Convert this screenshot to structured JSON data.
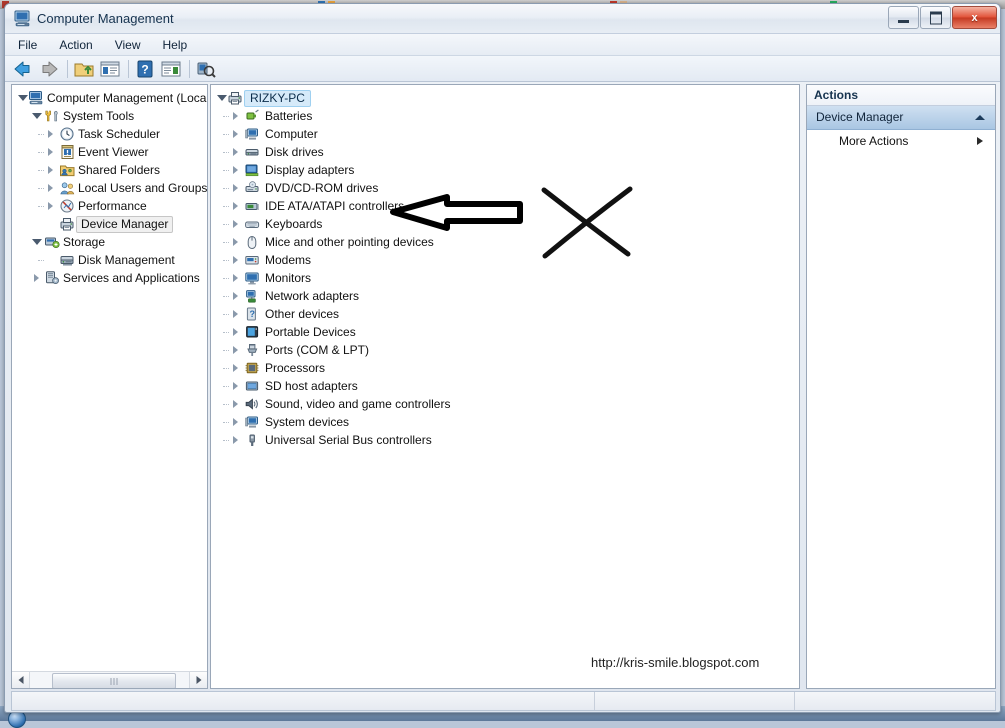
{
  "window": {
    "title": "Computer Management",
    "icon": "computer-management-icon",
    "buttons": {
      "minimize": "minimize",
      "maximize": "maximize",
      "close": "x"
    }
  },
  "menu": {
    "items": [
      "File",
      "Action",
      "View",
      "Help"
    ]
  },
  "toolbar": {
    "buttons": [
      {
        "name": "back-icon",
        "label": "Back"
      },
      {
        "name": "forward-icon",
        "label": "Forward"
      },
      {
        "name": "up-folder-icon",
        "label": "Up One Level"
      },
      {
        "name": "show-console-tree-icon",
        "label": "Show/Hide Console Tree"
      },
      {
        "name": "help-icon",
        "label": "Help"
      },
      {
        "name": "show-action-pane-icon",
        "label": "Show/Hide Action Pane"
      },
      {
        "name": "refresh-scan-icon",
        "label": "Scan for hardware changes"
      }
    ]
  },
  "console_tree": {
    "root": {
      "label": "Computer Management (Local",
      "icon": "computer-icon",
      "state": "expanded"
    },
    "items": [
      {
        "label": "System Tools",
        "icon": "system-tools-icon",
        "indent": 1,
        "state": "expanded",
        "selected": false
      },
      {
        "label": "Task Scheduler",
        "icon": "clock-icon",
        "indent": 2,
        "state": "collapsed",
        "selected": false
      },
      {
        "label": "Event Viewer",
        "icon": "event-viewer-icon",
        "indent": 2,
        "state": "collapsed",
        "selected": false
      },
      {
        "label": "Shared Folders",
        "icon": "shared-folders-icon",
        "indent": 2,
        "state": "collapsed",
        "selected": false
      },
      {
        "label": "Local Users and Groups",
        "icon": "users-icon",
        "indent": 2,
        "state": "collapsed",
        "selected": false
      },
      {
        "label": "Performance",
        "icon": "performance-icon",
        "indent": 2,
        "state": "collapsed",
        "selected": false
      },
      {
        "label": "Device Manager",
        "icon": "device-manager-icon",
        "indent": 2,
        "state": "leaf",
        "selected": true
      },
      {
        "label": "Storage",
        "icon": "storage-icon",
        "indent": 1,
        "state": "expanded",
        "selected": false
      },
      {
        "label": "Disk Management",
        "icon": "disk-management-icon",
        "indent": 2,
        "state": "leaf",
        "selected": false
      },
      {
        "label": "Services and Applications",
        "icon": "services-icon",
        "indent": 1,
        "state": "collapsed",
        "selected": false
      }
    ]
  },
  "device_tree": {
    "root": {
      "label": "RIZKY-PC",
      "icon": "computer-node-icon",
      "state": "expanded",
      "selected": true
    },
    "items": [
      {
        "label": "Batteries",
        "icon": "battery-icon"
      },
      {
        "label": "Computer",
        "icon": "computer-device-icon"
      },
      {
        "label": "Disk drives",
        "icon": "disk-drive-icon"
      },
      {
        "label": "Display adapters",
        "icon": "display-adapter-icon"
      },
      {
        "label": "DVD/CD-ROM drives",
        "icon": "dvd-drive-icon"
      },
      {
        "label": "IDE ATA/ATAPI controllers",
        "icon": "ide-controller-icon"
      },
      {
        "label": "Keyboards",
        "icon": "keyboard-icon"
      },
      {
        "label": "Mice and other pointing devices",
        "icon": "mouse-icon"
      },
      {
        "label": "Modems",
        "icon": "modem-icon"
      },
      {
        "label": "Monitors",
        "icon": "monitor-icon"
      },
      {
        "label": "Network adapters",
        "icon": "network-adapter-icon"
      },
      {
        "label": "Other devices",
        "icon": "other-device-icon"
      },
      {
        "label": "Portable Devices",
        "icon": "portable-device-icon"
      },
      {
        "label": "Ports (COM & LPT)",
        "icon": "port-icon"
      },
      {
        "label": "Processors",
        "icon": "processor-icon"
      },
      {
        "label": "SD host adapters",
        "icon": "sd-host-adapter-icon"
      },
      {
        "label": "Sound, video and game controllers",
        "icon": "sound-icon"
      },
      {
        "label": "System devices",
        "icon": "system-device-icon"
      },
      {
        "label": "Universal Serial Bus controllers",
        "icon": "usb-icon"
      }
    ]
  },
  "actions_pane": {
    "header": "Actions",
    "group": "Device Manager",
    "rows": [
      "More Actions"
    ]
  },
  "watermark": "http://kris-smile.blogspot.com",
  "annotations": {
    "arrow": "left-pointing-arrow",
    "cross": "hand-drawn-x-mark"
  },
  "colors": {
    "selection_blue": "#d6eaf9",
    "actions_group": "#a9c6e3",
    "close_button": "#e2543a",
    "title_text": "#16334f"
  }
}
